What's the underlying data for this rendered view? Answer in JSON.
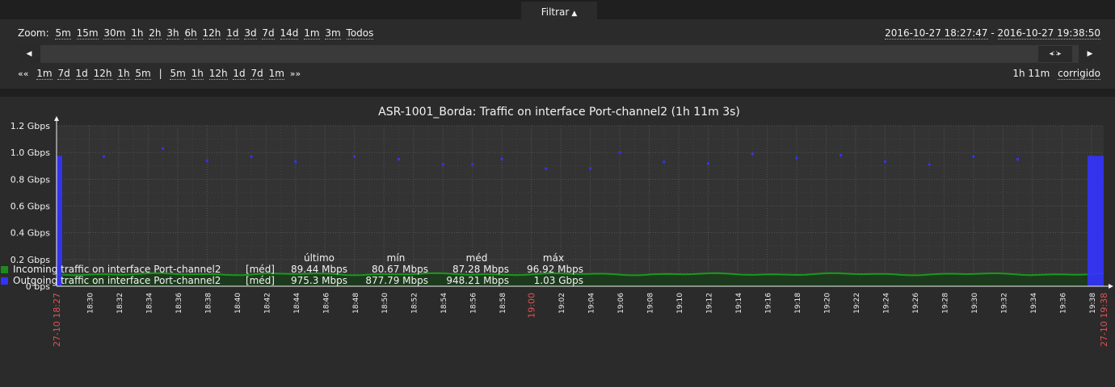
{
  "filter": {
    "label": "Filtrar"
  },
  "zoom": {
    "label": "Zoom:",
    "options": [
      "5m",
      "15m",
      "30m",
      "1h",
      "2h",
      "3h",
      "6h",
      "12h",
      "1d",
      "3d",
      "7d",
      "14d",
      "1m",
      "3m",
      "Todos"
    ]
  },
  "timerange": {
    "from": "2016-10-27 18:27:47",
    "separator": "-",
    "to": "2016-10-27 19:38:50"
  },
  "nav": {
    "back_symbol": "««",
    "back": [
      "1m",
      "7d",
      "1d",
      "12h",
      "1h",
      "5m"
    ],
    "separator": "|",
    "forward": [
      "5m",
      "1h",
      "12h",
      "1d",
      "7d",
      "1m"
    ],
    "forward_symbol": "»»"
  },
  "period": {
    "duration": "1h 11m",
    "mode": "corrigido"
  },
  "chart_data": {
    "type": "line",
    "title": "ASR-1001_Borda: Traffic on interface Port-channel2 (1h 11m 3s)",
    "y_unit": "bps",
    "ylim": [
      0,
      1.2
    ],
    "y_ticks": [
      "0 bps",
      "0.2 Gbps",
      "0.4 Gbps",
      "0.6 Gbps",
      "0.8 Gbps",
      "1.0 Gbps",
      "1.2 Gbps"
    ],
    "y_tick_values": [
      0,
      0.2,
      0.4,
      0.6,
      0.8,
      1.0,
      1.2
    ],
    "x_start_label": "27-10 18:27",
    "x_end_label": "27-10 19:38",
    "x_mid_label": "19:00",
    "x_labels": [
      "18:30",
      "18:32",
      "18:34",
      "18:36",
      "18:38",
      "18:40",
      "18:42",
      "18:44",
      "18:46",
      "18:48",
      "18:50",
      "18:52",
      "18:54",
      "18:56",
      "18:58",
      "19:02",
      "19:04",
      "19:06",
      "19:08",
      "19:10",
      "19:12",
      "19:14",
      "19:16",
      "19:18",
      "19:20",
      "19:22",
      "19:24",
      "19:26",
      "19:28",
      "19:30",
      "19:32",
      "19:34",
      "19:36",
      "19:38"
    ],
    "series": [
      {
        "name": "Incoming traffic on interface Port-channel2",
        "color": "#1a8c1a",
        "style": "area",
        "value_gbps": 0.09
      },
      {
        "name": "Outgoing traffic on interface Port-channel2",
        "color": "#3333ff",
        "style": "points",
        "points": [
          {
            "t": "18:27:47",
            "v": 0.975
          },
          {
            "t": "18:31",
            "v": 0.97
          },
          {
            "t": "18:35",
            "v": 1.03
          },
          {
            "t": "18:38",
            "v": 0.94
          },
          {
            "t": "18:41",
            "v": 0.97
          },
          {
            "t": "18:44",
            "v": 0.93
          },
          {
            "t": "18:48",
            "v": 0.97
          },
          {
            "t": "18:51",
            "v": 0.95
          },
          {
            "t": "18:54",
            "v": 0.91
          },
          {
            "t": "18:56",
            "v": 0.91
          },
          {
            "t": "18:58",
            "v": 0.95
          },
          {
            "t": "19:01",
            "v": 0.88
          },
          {
            "t": "19:04",
            "v": 0.88
          },
          {
            "t": "19:06",
            "v": 1.0
          },
          {
            "t": "19:09",
            "v": 0.93
          },
          {
            "t": "19:12",
            "v": 0.92
          },
          {
            "t": "19:15",
            "v": 0.99
          },
          {
            "t": "19:18",
            "v": 0.96
          },
          {
            "t": "19:21",
            "v": 0.98
          },
          {
            "t": "19:24",
            "v": 0.93
          },
          {
            "t": "19:27",
            "v": 0.91
          },
          {
            "t": "19:30",
            "v": 0.97
          },
          {
            "t": "19:33",
            "v": 0.95
          },
          {
            "t": "19:38:50",
            "v": 0.975
          }
        ]
      }
    ]
  },
  "legend": {
    "headers": {
      "last": "último",
      "min": "mín",
      "avg": "méd",
      "max": "máx"
    },
    "rows": [
      {
        "name": "Incoming traffic on interface Port-channel2",
        "color": "#1a8c1a",
        "func": "[méd]",
        "last": "89.44 Mbps",
        "min": "80.67 Mbps",
        "avg": "87.28 Mbps",
        "max": "96.92 Mbps"
      },
      {
        "name": "Outgoing traffic on interface Port-channel2",
        "color": "#3333ff",
        "func": "[méd]",
        "last": "975.3 Mbps",
        "min": "877.79 Mbps",
        "avg": "948.21 Mbps",
        "max": "1.03 Gbps"
      }
    ]
  }
}
